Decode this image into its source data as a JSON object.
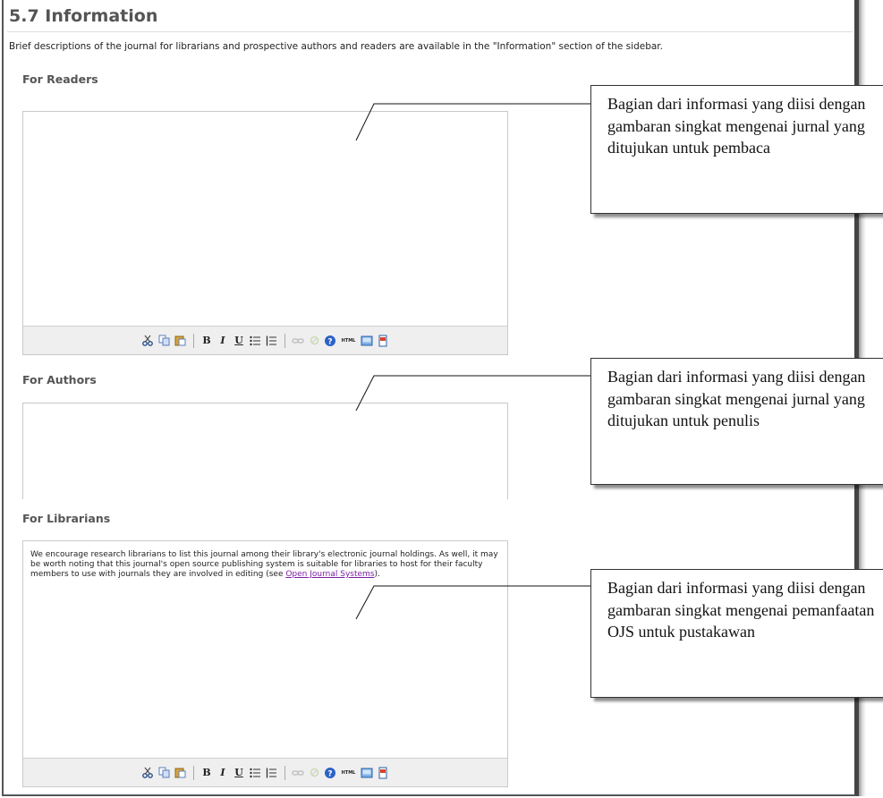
{
  "section": {
    "title": "5.7 Information",
    "description": "Brief descriptions of the journal for librarians and prospective authors and readers are available in the \"Information\" section of the sidebar."
  },
  "fields": {
    "readers": {
      "label": "For Readers",
      "value": ""
    },
    "authors": {
      "label": "For Authors",
      "value": ""
    },
    "librarians": {
      "label": "For Librarians",
      "text_before_link": "We encourage research librarians to list this journal among their library's electronic journal holdings. As well, it may be worth noting that this journal's open source publishing system is suitable for libraries to host for their faculty members to use with journals they are involved in editing (see ",
      "link_text": "Open Journal Systems",
      "text_after_link": ")."
    }
  },
  "toolbar": {
    "buttons": [
      "cut-icon",
      "copy-icon",
      "paste-icon",
      "bold-icon",
      "italic-icon",
      "underline-icon",
      "bullet-list-icon",
      "numbered-list-icon",
      "link-icon",
      "unlink-icon",
      "help-icon",
      "html-icon",
      "image-icon",
      "fullscreen-icon"
    ],
    "bold": "B",
    "italic": "I",
    "underline": "U",
    "html": "HTML"
  },
  "callouts": {
    "readers": "Bagian dari informasi yang diisi dengan gambaran singkat mengenai jurnal yang ditujukan untuk pembaca",
    "authors": "Bagian dari informasi yang diisi dengan gambaran singkat mengenai jurnal yang ditujukan untuk penulis",
    "librarians": "Bagian dari informasi yang diisi dengan gambaran singkat mengenai pemanfaatan OJS untuk pustakawan"
  }
}
